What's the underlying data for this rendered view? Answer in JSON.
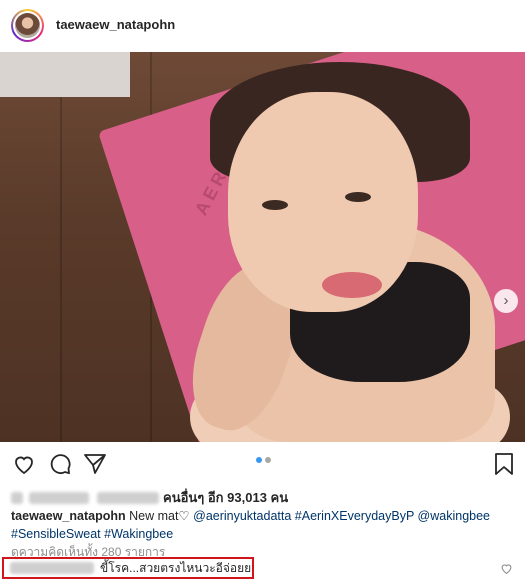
{
  "header": {
    "username": "taewaew_natapohn"
  },
  "photo": {
    "mat_brand": "AERIN",
    "carousel_arrow": "›"
  },
  "carousel": {
    "active_index": 0,
    "count": 2
  },
  "likes": {
    "text": "คนอื่นๆ อีก 93,013 คน"
  },
  "caption": {
    "username": "taewaew_natapohn",
    "text_prefix": " New mat",
    "text_mid": " ",
    "tag1": "@aerinyuktadatta",
    "tag2": "#AerinXEverydayByP",
    "tag3": "@wakingbee",
    "tag4": "#SensibleSweat",
    "tag5": "#Wakingbee"
  },
  "comments": {
    "view_all": "ดูความคิดเห็นทั้ง 280 รายการ",
    "highlighted_text": "ขี้โรค...สวยตรงไหนวะอีจ่อยย"
  },
  "icons": {
    "like": "heart-icon",
    "comment": "comment-icon",
    "share": "send-icon",
    "save": "bookmark-icon"
  },
  "colors": {
    "highlight_border": "#d0161a",
    "link": "#003569",
    "dot_active": "#3897f0"
  }
}
